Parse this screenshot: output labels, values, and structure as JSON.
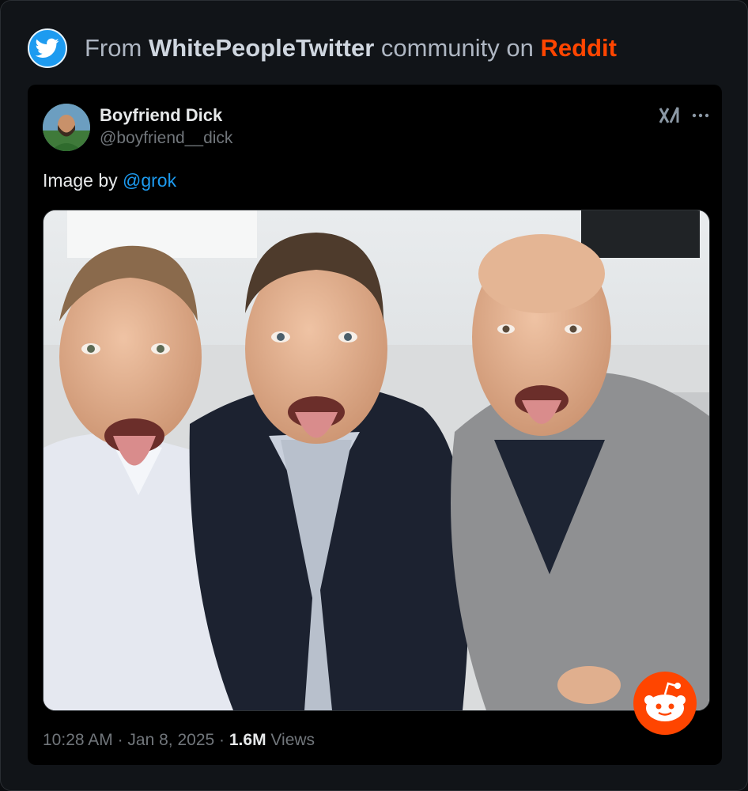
{
  "header": {
    "prefix": "From",
    "community": "WhitePeopleTwitter",
    "middle": "community on",
    "platform": "Reddit",
    "icon": "twitter-bird-icon"
  },
  "tweet": {
    "author_name": "Boyfriend Dick",
    "author_handle": "@boyfriend__dick",
    "text_prefix": "Image by ",
    "text_mention": "@grok",
    "media_alt": "Photo of three men sticking out their tongues",
    "time": "10:28 AM",
    "date": "Jan 8, 2025",
    "views_count": "1.6M",
    "views_label": "Views",
    "separator": "·"
  },
  "icons": {
    "grok": "grok-icon",
    "more": "more-options-icon",
    "watermark": "reddit-snoo-icon"
  },
  "colors": {
    "accent": "#1d9bf0",
    "reddit": "#ff4500",
    "background": "#111418",
    "card": "#000000"
  }
}
